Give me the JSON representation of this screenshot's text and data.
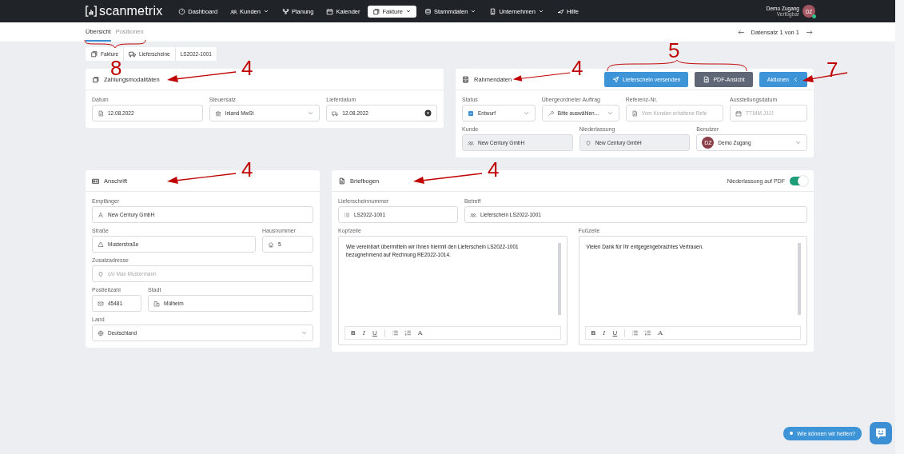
{
  "nav": {
    "logo": "scanmetrix",
    "items": [
      {
        "label": "Dashboard",
        "dropdown": false,
        "selected": false
      },
      {
        "label": "Kunden",
        "dropdown": true,
        "selected": false
      },
      {
        "label": "Planung",
        "dropdown": false,
        "selected": false
      },
      {
        "label": "Kalender",
        "dropdown": false,
        "selected": false
      },
      {
        "label": "Fakture",
        "dropdown": true,
        "selected": true
      },
      {
        "label": "Stammdaten",
        "dropdown": true,
        "selected": false
      },
      {
        "label": "Unternehmen",
        "dropdown": true,
        "selected": false
      },
      {
        "label": "Hilfe",
        "dropdown": false,
        "selected": false
      }
    ],
    "user": {
      "name": "Demo Zugang",
      "status": "Verfügbar",
      "initials": "DZ",
      "online": true
    }
  },
  "subnav": {
    "tabs": [
      {
        "label": "Übersicht",
        "selected": true
      },
      {
        "label": "Positionen",
        "selected": false
      }
    ],
    "callout": "8",
    "record": "Datensatz 1 von 1"
  },
  "breadcrumb": [
    "Fakture",
    "Lieferscheine",
    "LS2022-1001"
  ],
  "payment": {
    "title": "Zahlungsmodalitäten",
    "callout": "4",
    "rows": [
      [
        {
          "label": "Datum",
          "kind": "text",
          "value": "12.08.2022"
        },
        {
          "label": "Steuersatz",
          "kind": "select",
          "value": "Inland MwSt"
        },
        {
          "label": "Lieferdatum",
          "kind": "clearable",
          "value": "12.08.2022"
        }
      ]
    ]
  },
  "frame": {
    "title": "Rahmendaten",
    "callout": "4",
    "buttons": [
      {
        "label": "Lieferschein versenden",
        "kind": "primary"
      },
      {
        "label": "PDF-Ansicht",
        "kind": "secondary"
      },
      {
        "label": "Aktionen",
        "kind": "menu"
      }
    ],
    "buttons_callout": "5",
    "menu_callout": "7",
    "rows": [
      [
        {
          "label": "Status",
          "kind": "select",
          "value": "Entwurf"
        },
        {
          "label": "Übergeordneter Auftrag",
          "kind": "select",
          "value": "Bitte auswählen..."
        },
        {
          "label": "Referenz-Nr.",
          "kind": "text",
          "placeholder": "Vom Kunden erhaltene Refe"
        },
        {
          "label": "Ausstellungsdatum",
          "kind": "text",
          "placeholder": "TT.MM.JJJJ"
        }
      ],
      [
        {
          "label": "Kunde",
          "kind": "readonly",
          "value": "New Century GmbH"
        },
        {
          "label": "Niederlassung",
          "kind": "readonly",
          "value": "New Century GmbH"
        },
        {
          "label": "Benutzer",
          "kind": "select",
          "avatar": "DZ",
          "value": "Demo Zugang"
        }
      ]
    ]
  },
  "address": {
    "title": "Anschrift",
    "callout": "4",
    "rows": [
      [
        {
          "label": "Empfänger",
          "kind": "text",
          "value": "New Century GmbH"
        }
      ],
      [
        {
          "label": "Straße",
          "kind": "text",
          "value": "Musterstraße"
        },
        {
          "label": "Hausnummer",
          "kind": "text",
          "value": "5"
        }
      ],
      [
        {
          "label": "Zusatzadresse",
          "kind": "text",
          "placeholder": "c/o Max Mustermann"
        }
      ],
      [
        {
          "label": "Postleitzahl",
          "kind": "text",
          "value": "45481"
        },
        {
          "label": "Stadt",
          "kind": "text",
          "value": "Mülheim"
        }
      ],
      [
        {
          "label": "Land",
          "kind": "select",
          "value": "Deutschland"
        }
      ]
    ]
  },
  "letterhead": {
    "title": "Briefbogen",
    "callout": "4",
    "toggle": {
      "label": "Niederlassung auf PDF",
      "on": true
    },
    "rows": [
      [
        {
          "label": "Lieferscheinnummer",
          "kind": "text",
          "value": "LS2022-1001"
        },
        {
          "label": "Betreff",
          "kind": "text",
          "value": "Lieferschein LS2022-1001"
        }
      ]
    ],
    "editors": [
      {
        "label": "Kopfzeile",
        "text": "Wie vereinbart übermitteln wir Ihnen hiermit den Lieferschein LS2022-1001 bezugnehmend auf Rechnung RE2022-1014.",
        "toolbar": [
          {
            "kind": "bold",
            "label": "B"
          },
          {
            "kind": "italic",
            "label": "I"
          },
          {
            "kind": "underline",
            "label": "U"
          },
          {
            "kind": "bullets"
          },
          {
            "kind": "numbers"
          },
          {
            "kind": "font",
            "label": "A"
          }
        ]
      },
      {
        "label": "Fußzeile",
        "text": "Vielen Dank für Ihr entgegengebrachtes Vertrauen.",
        "toolbar": [
          {
            "kind": "bold",
            "label": "B"
          },
          {
            "kind": "italic",
            "label": "I"
          },
          {
            "kind": "underline",
            "label": "U"
          },
          {
            "kind": "bullets"
          },
          {
            "kind": "numbers"
          },
          {
            "kind": "font",
            "label": "A"
          }
        ]
      }
    ]
  },
  "chat": {
    "label": "Wie können wir helfen?"
  }
}
